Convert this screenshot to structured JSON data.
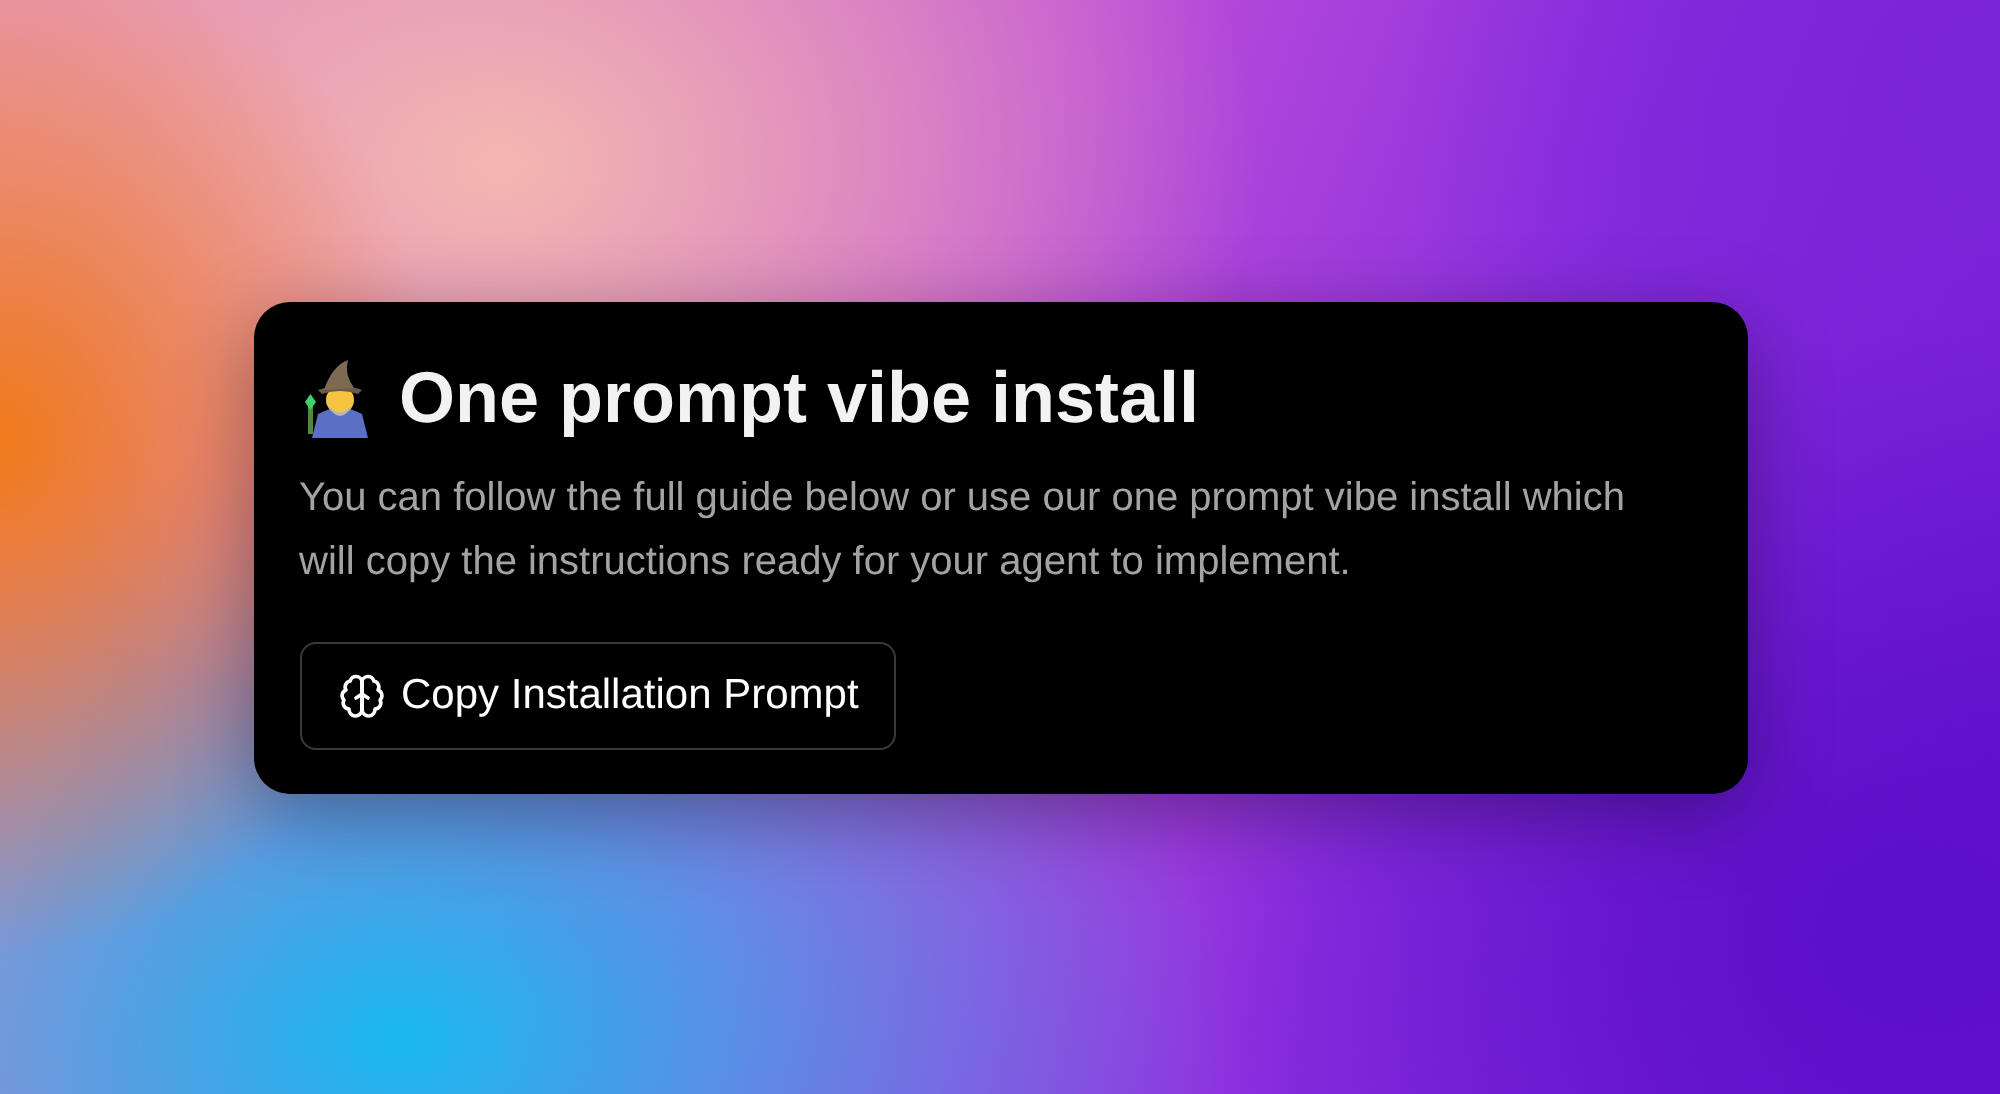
{
  "card": {
    "title": "One prompt vibe install",
    "description": "You can follow the full guide below or use our one prompt vibe install which will copy the instructions ready for your agent to implement.",
    "button": {
      "label": "Copy Installation Prompt"
    }
  }
}
